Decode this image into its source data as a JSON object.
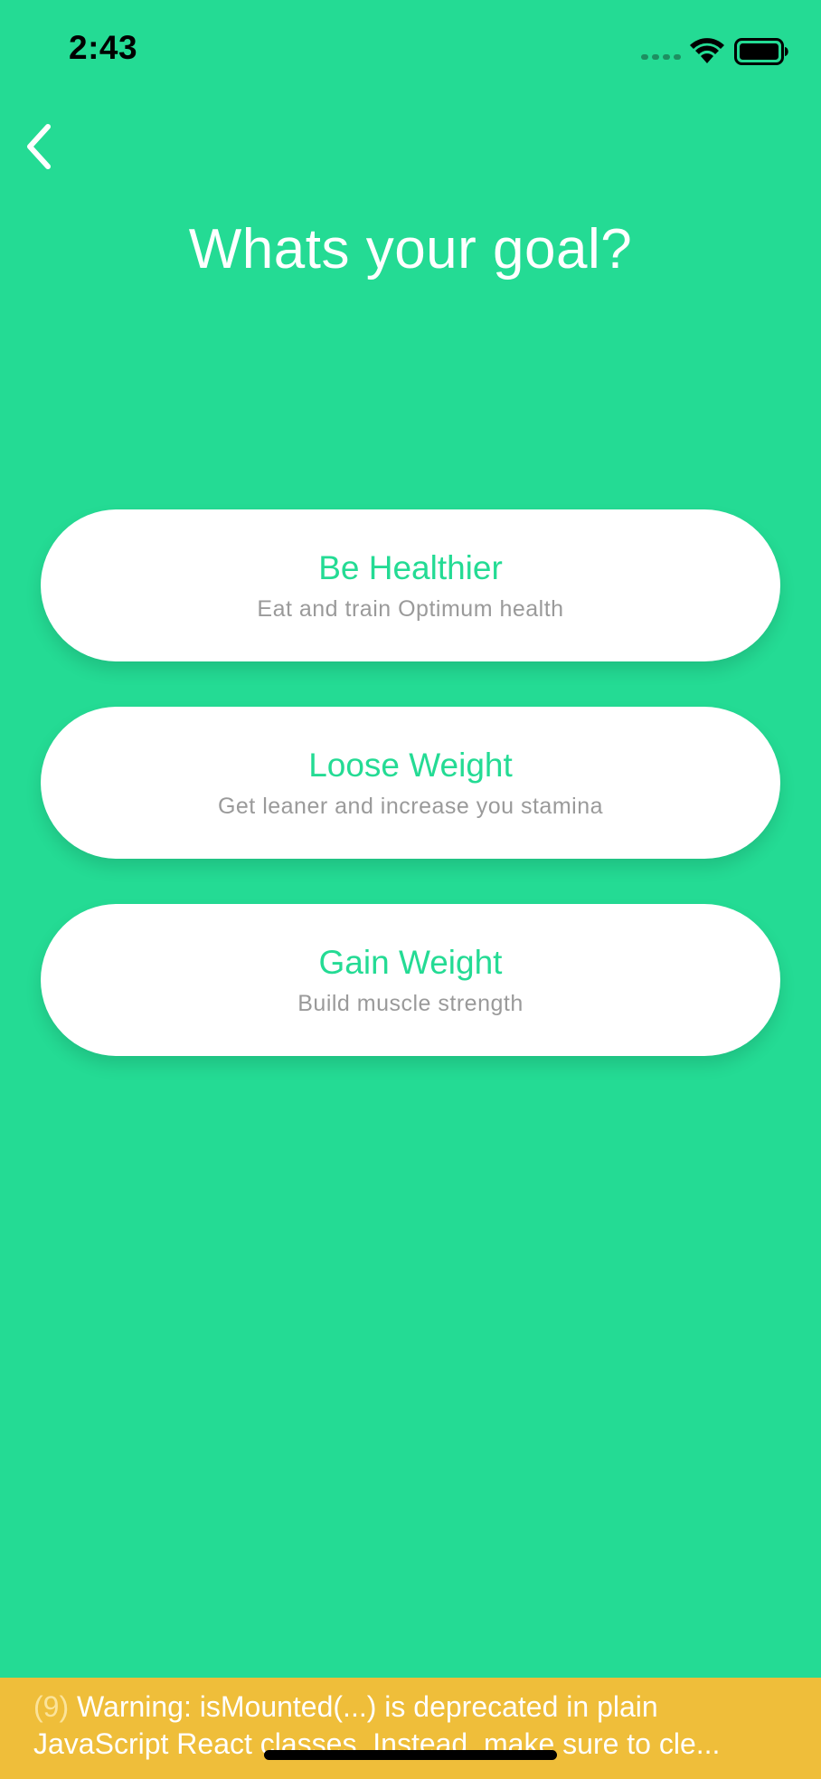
{
  "status_bar": {
    "time": "2:43"
  },
  "header": {
    "title": "Whats your goal?"
  },
  "options": [
    {
      "title": "Be Healthier",
      "subtitle": "Eat and train Optimum health"
    },
    {
      "title": "Loose Weight",
      "subtitle": "Get leaner and increase you stamina"
    },
    {
      "title": "Gain Weight",
      "subtitle": "Build muscle strength"
    }
  ],
  "warning": {
    "count": "(9)",
    "line1": "Warning: isMounted(...) is deprecated in plain",
    "line2": "JavaScript React classes. Instead, make sure to cle..."
  },
  "colors": {
    "background": "#24db94",
    "accent": "#24db94",
    "warning": "#efbe3a"
  },
  "icons": {
    "back": "chevron-left-icon",
    "signal": "cellular-signal-icon",
    "wifi": "wifi-icon",
    "battery": "battery-icon"
  }
}
